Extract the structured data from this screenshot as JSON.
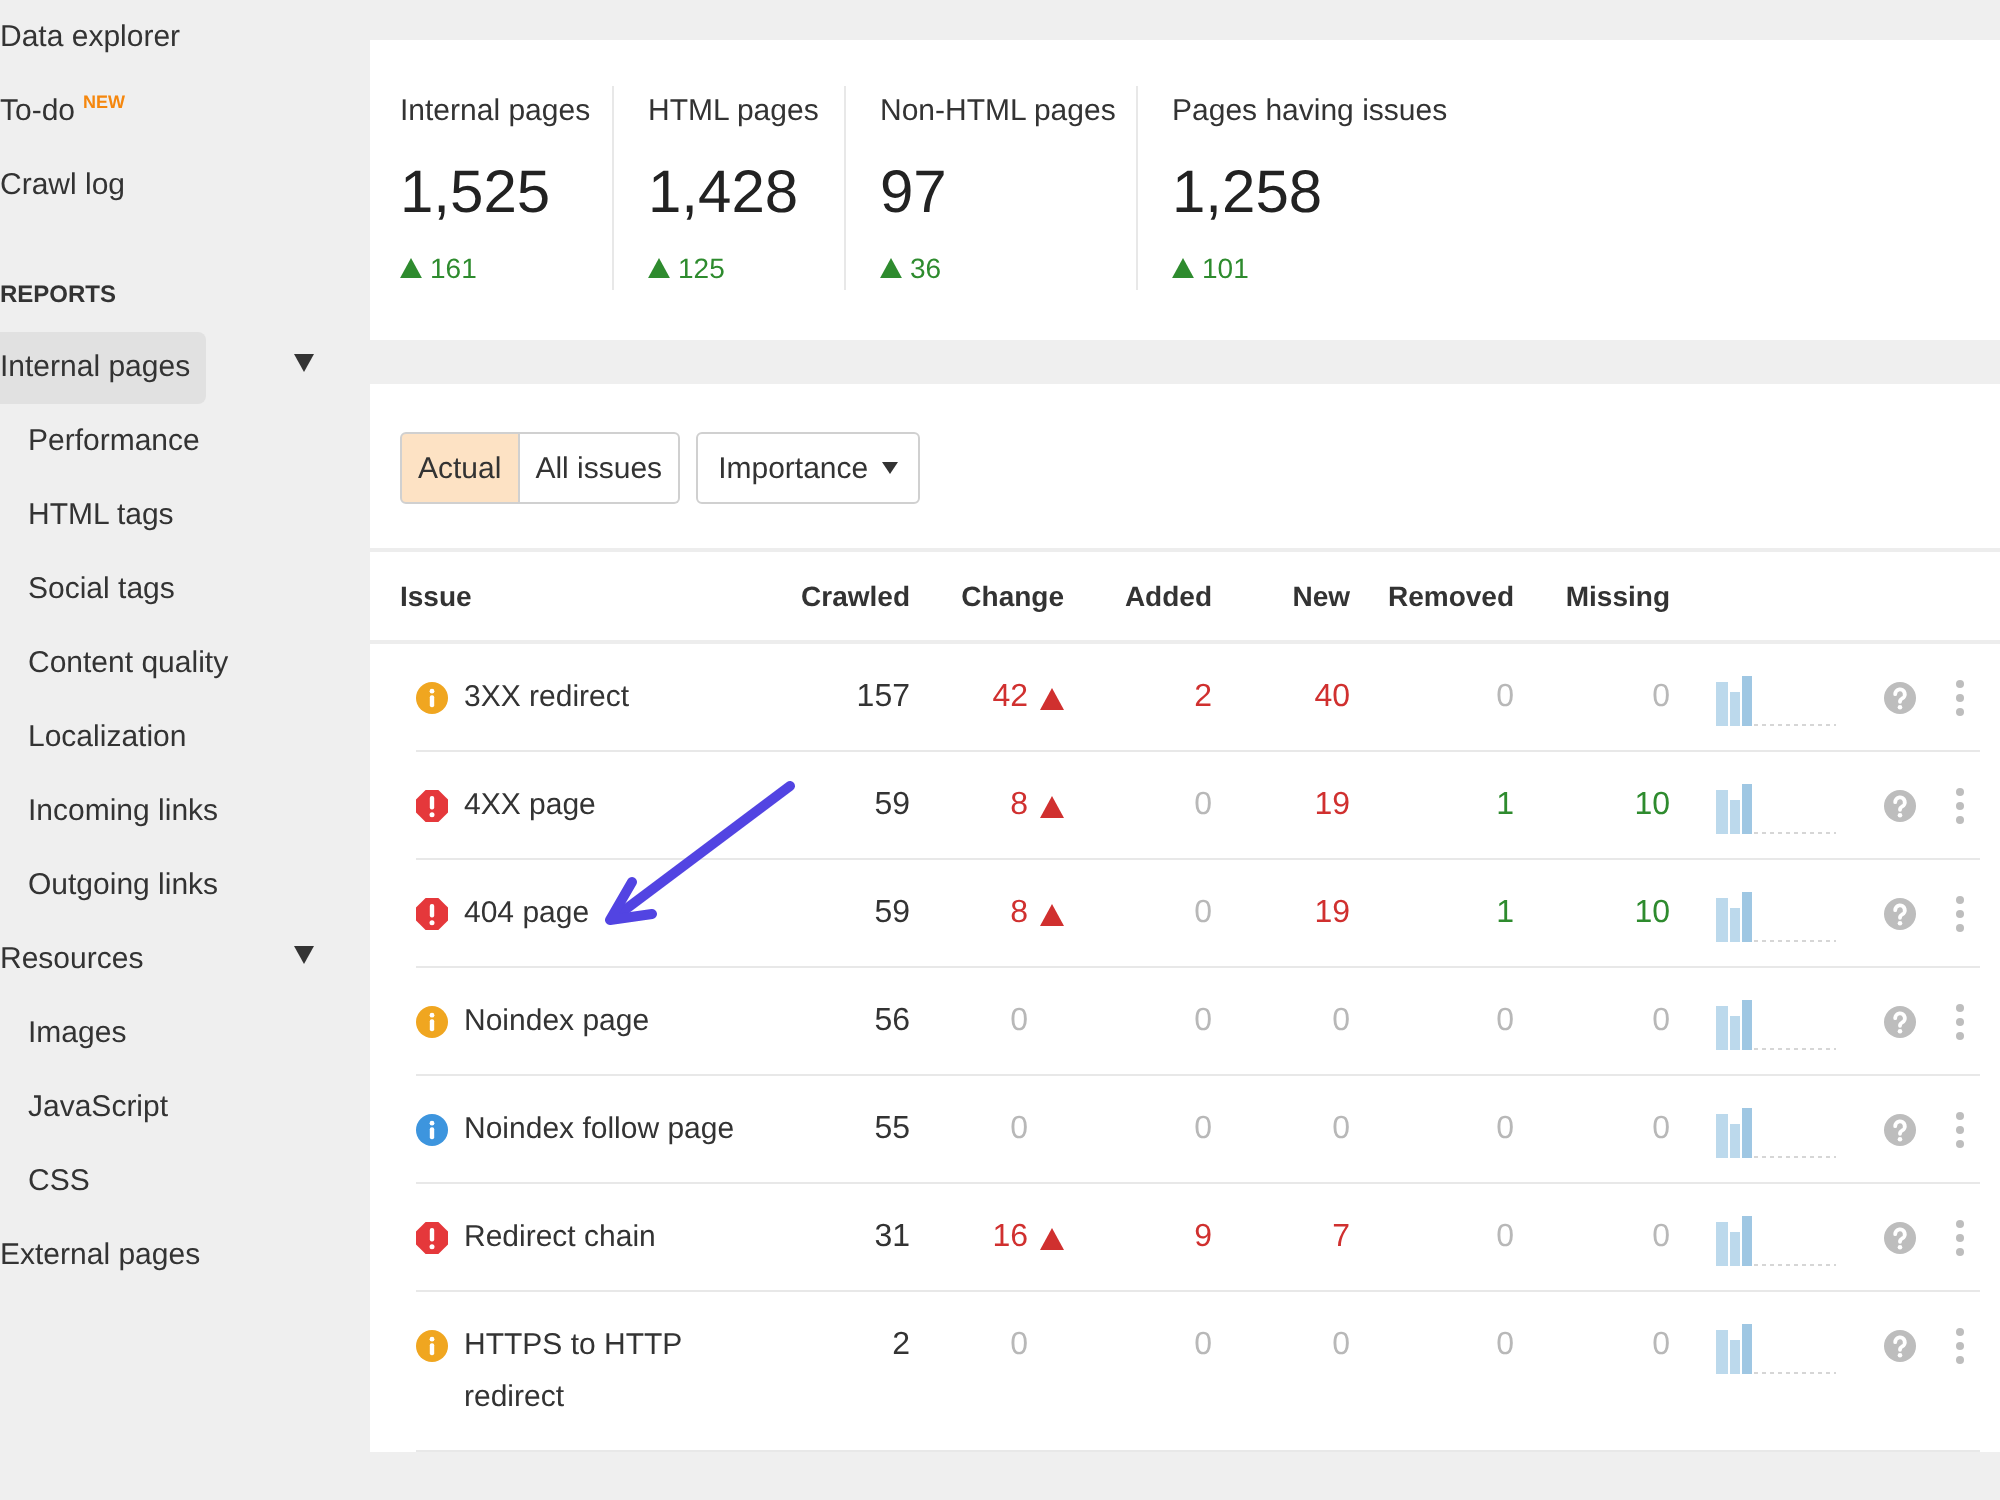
{
  "sidebar": {
    "items": [
      {
        "label": "Data explorer",
        "selected": false
      },
      {
        "label": "To-do",
        "badge": "NEW",
        "selected": false
      },
      {
        "label": "Crawl log",
        "selected": false
      }
    ],
    "reports": {
      "title": "REPORTS",
      "items": [
        {
          "label": "Internal pages",
          "selected": true,
          "expanded": true,
          "children": [
            {
              "label": "Performance",
              "selected": false
            },
            {
              "label": "HTML tags",
              "selected": false
            },
            {
              "label": "Social tags",
              "selected": false
            },
            {
              "label": "Content quality",
              "selected": false
            },
            {
              "label": "Localization",
              "selected": false
            },
            {
              "label": "Incoming links",
              "selected": false
            },
            {
              "label": "Outgoing links",
              "selected": false
            }
          ]
        },
        {
          "label": "Resources",
          "selected": false,
          "expanded": true,
          "children": [
            {
              "label": "Images",
              "selected": false
            },
            {
              "label": "JavaScript",
              "selected": false
            },
            {
              "label": "CSS",
              "selected": false
            }
          ]
        },
        {
          "label": "External pages",
          "selected": false
        }
      ]
    }
  },
  "stats": [
    {
      "label": "Internal pages",
      "value": "1,525",
      "delta": "161",
      "increase": true
    },
    {
      "label": "HTML pages",
      "value": "1,428",
      "delta": "125",
      "increase": true
    },
    {
      "label": "Non-HTML pages",
      "value": "97",
      "delta": "36",
      "increase": true
    },
    {
      "label": "Pages having issues",
      "value": "1,258",
      "delta": "101",
      "increase": true
    }
  ],
  "filters": {
    "segments": [
      {
        "label": "Actual",
        "selected": true
      },
      {
        "label": "All issues",
        "selected": false
      }
    ],
    "dropdown": {
      "label": "Importance"
    }
  },
  "table": {
    "columns": [
      "Issue",
      "Crawled",
      "Change",
      "Added",
      "New",
      "Removed",
      "Missing"
    ],
    "rows": [
      {
        "kind": "warning",
        "cells": [
          {
            "value": "3XX redirect"
          },
          {
            "value": "157",
            "color": "#333333"
          },
          {
            "value": "42",
            "color": "#d0302f",
            "increase": true
          },
          {
            "value": "2",
            "color": "#d0302f"
          },
          {
            "value": "40",
            "color": "#d0302f"
          },
          {
            "value": "0",
            "color": "#b8b8b8"
          },
          {
            "value": "0",
            "color": "#b8b8b8"
          }
        ]
      },
      {
        "kind": "error",
        "cells": [
          {
            "value": "4XX page"
          },
          {
            "value": "59",
            "color": "#333333"
          },
          {
            "value": "8",
            "color": "#d0302f",
            "increase": true
          },
          {
            "value": "0",
            "color": "#b8b8b8"
          },
          {
            "value": "19",
            "color": "#d0302f"
          },
          {
            "value": "1",
            "color": "#2e8b2e"
          },
          {
            "value": "10",
            "color": "#2e8b2e"
          }
        ]
      },
      {
        "kind": "error",
        "cells": [
          {
            "value": "404 page"
          },
          {
            "value": "59",
            "color": "#333333"
          },
          {
            "value": "8",
            "color": "#d0302f",
            "increase": true
          },
          {
            "value": "0",
            "color": "#b8b8b8"
          },
          {
            "value": "19",
            "color": "#d0302f"
          },
          {
            "value": "1",
            "color": "#2e8b2e"
          },
          {
            "value": "10",
            "color": "#2e8b2e"
          }
        ]
      },
      {
        "kind": "warning",
        "cells": [
          {
            "value": "Noindex page"
          },
          {
            "value": "56",
            "color": "#333333"
          },
          {
            "value": "0",
            "color": "#b8b8b8"
          },
          {
            "value": "0",
            "color": "#b8b8b8"
          },
          {
            "value": "0",
            "color": "#b8b8b8"
          },
          {
            "value": "0",
            "color": "#b8b8b8"
          },
          {
            "value": "0",
            "color": "#b8b8b8"
          }
        ]
      },
      {
        "kind": "notice",
        "cells": [
          {
            "value": "Noindex follow page"
          },
          {
            "value": "55",
            "color": "#333333"
          },
          {
            "value": "0",
            "color": "#b8b8b8"
          },
          {
            "value": "0",
            "color": "#b8b8b8"
          },
          {
            "value": "0",
            "color": "#b8b8b8"
          },
          {
            "value": "0",
            "color": "#b8b8b8"
          },
          {
            "value": "0",
            "color": "#b8b8b8"
          }
        ]
      },
      {
        "kind": "error",
        "cells": [
          {
            "value": "Redirect chain"
          },
          {
            "value": "31",
            "color": "#333333"
          },
          {
            "value": "16",
            "color": "#d0302f",
            "increase": true
          },
          {
            "value": "9",
            "color": "#d0302f"
          },
          {
            "value": "7",
            "color": "#d0302f"
          },
          {
            "value": "0",
            "color": "#b8b8b8"
          },
          {
            "value": "0",
            "color": "#b8b8b8"
          }
        ]
      },
      {
        "kind": "warning",
        "cells": [
          {
            "value": "HTTPS to HTTP redirect"
          },
          {
            "value": "2",
            "color": "#333333"
          },
          {
            "value": "0",
            "color": "#b8b8b8"
          },
          {
            "value": "0",
            "color": "#b8b8b8"
          },
          {
            "value": "0",
            "color": "#b8b8b8"
          },
          {
            "value": "0",
            "color": "#b8b8b8"
          },
          {
            "value": "0",
            "color": "#b8b8b8"
          }
        ]
      }
    ]
  }
}
